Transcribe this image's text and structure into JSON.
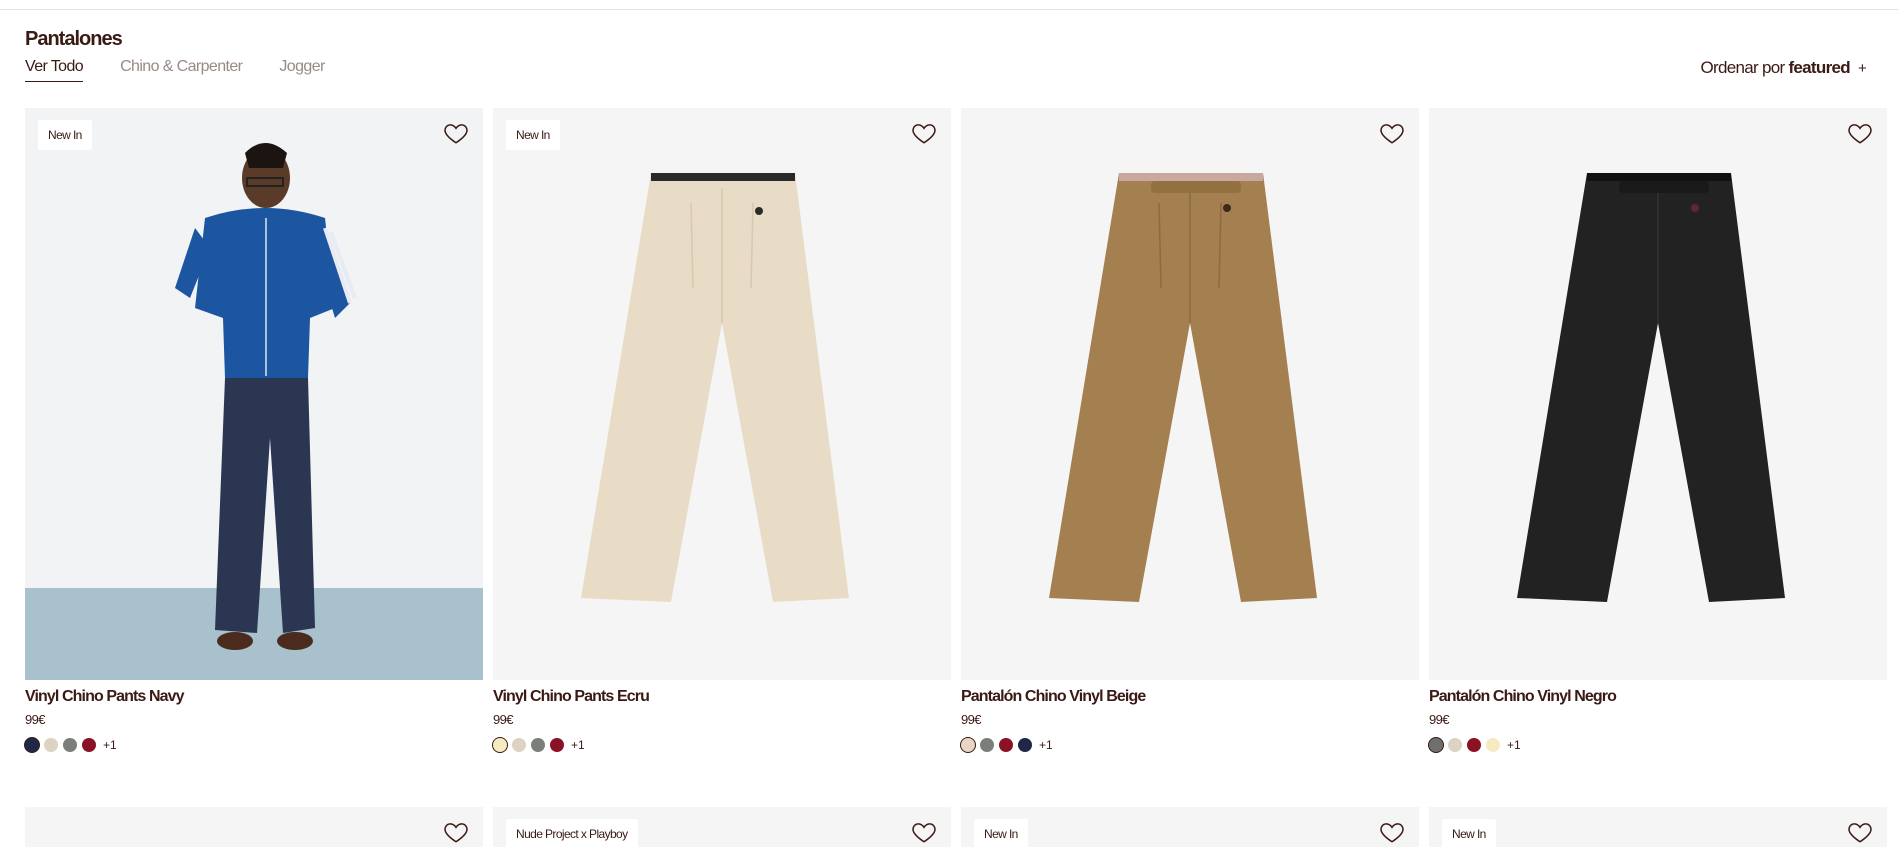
{
  "header": {
    "title": "Pantalones",
    "tabs": [
      {
        "label": "Ver Todo",
        "active": true
      },
      {
        "label": "Chino & Carpenter",
        "active": false
      },
      {
        "label": "Jogger",
        "active": false
      }
    ],
    "sort_prefix": "Ordenar por",
    "sort_value": "featured",
    "sort_icon": "+"
  },
  "products": [
    {
      "name": "Vinyl Chino Pants Navy",
      "price": "99€",
      "badge": "New In",
      "image": "model-wearing-navy-pants",
      "swatches": [
        "#202848",
        "#ddd3c2",
        "#7a7f7a",
        "#8a1224"
      ],
      "selected_swatch": 0,
      "more": "+1"
    },
    {
      "name": "Vinyl Chino Pants Ecru",
      "price": "99€",
      "badge": "New In",
      "image": "ecru-trousers",
      "swatches": [
        "#f4ecc0",
        "#ddd3c2",
        "#7a7f7a",
        "#8a1224"
      ],
      "selected_swatch": 0,
      "more": "+1"
    },
    {
      "name": "Pantalón Chino Vinyl Beige",
      "price": "99€",
      "badge": "",
      "image": "beige-trousers",
      "swatches": [
        "#e6d6c4",
        "#7a7f7a",
        "#8a1224",
        "#202848"
      ],
      "selected_swatch": 0,
      "more": "+1"
    },
    {
      "name": "Pantalón Chino Vinyl Negro",
      "price": "99€",
      "badge": "",
      "image": "black-trousers",
      "swatches": [
        "#6e7070",
        "#ddd3c2",
        "#8a1224",
        "#f4ecc0"
      ],
      "selected_swatch": 0,
      "more": "+1"
    }
  ],
  "next_row_badges": [
    "",
    "Nude Project x Playboy",
    "New In",
    "New In"
  ],
  "colors": {
    "text": "#3a1a14",
    "card_bg": "#f5f5f5"
  }
}
